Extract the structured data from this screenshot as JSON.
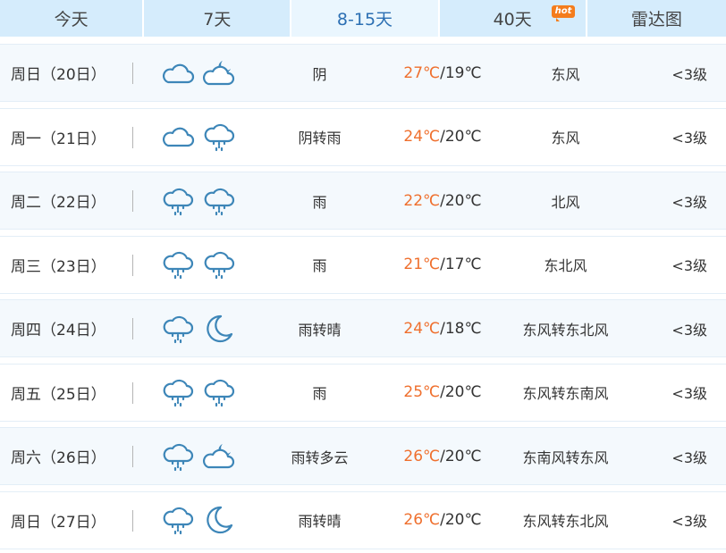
{
  "tabs": [
    {
      "label": "今天",
      "active": false
    },
    {
      "label": "7天",
      "active": false
    },
    {
      "label": "8-15天",
      "active": true
    },
    {
      "label": "40天",
      "active": false,
      "badge": "hot"
    },
    {
      "label": "雷达图",
      "active": false
    }
  ],
  "rows": [
    {
      "day": "周日（20日）",
      "icon1": "cloud-icon",
      "icon2": "cloud-moon-icon",
      "desc": "阴",
      "high": "27℃",
      "low": "/19℃",
      "wind": "东风",
      "level": "<3级"
    },
    {
      "day": "周一（21日）",
      "icon1": "cloud-icon",
      "icon2": "rain-icon",
      "desc": "阴转雨",
      "high": "24℃",
      "low": "/20℃",
      "wind": "东风",
      "level": "<3级"
    },
    {
      "day": "周二（22日）",
      "icon1": "rain-icon",
      "icon2": "rain-icon",
      "desc": "雨",
      "high": "22℃",
      "low": "/20℃",
      "wind": "北风",
      "level": "<3级"
    },
    {
      "day": "周三（23日）",
      "icon1": "rain-icon",
      "icon2": "rain-icon",
      "desc": "雨",
      "high": "21℃",
      "low": "/17℃",
      "wind": "东北风",
      "level": "<3级"
    },
    {
      "day": "周四（24日）",
      "icon1": "rain-icon",
      "icon2": "moon-icon",
      "desc": "雨转晴",
      "high": "24℃",
      "low": "/18℃",
      "wind": "东风转东北风",
      "level": "<3级"
    },
    {
      "day": "周五（25日）",
      "icon1": "rain-icon",
      "icon2": "rain-icon",
      "desc": "雨",
      "high": "25℃",
      "low": "/20℃",
      "wind": "东风转东南风",
      "level": "<3级"
    },
    {
      "day": "周六（26日）",
      "icon1": "rain-icon",
      "icon2": "cloud-moon-icon",
      "desc": "雨转多云",
      "high": "26℃",
      "low": "/20℃",
      "wind": "东南风转东风",
      "level": "<3级"
    },
    {
      "day": "周日（27日）",
      "icon1": "rain-icon",
      "icon2": "moon-icon",
      "desc": "雨转晴",
      "high": "26℃",
      "low": "/20℃",
      "wind": "东风转东北风",
      "level": "<3级"
    }
  ],
  "colors": {
    "accent": "#2c6fb3",
    "high_temp": "#ef6f2d",
    "hot_badge": "#f47c1c",
    "icon_stroke": "#3d86b8"
  }
}
